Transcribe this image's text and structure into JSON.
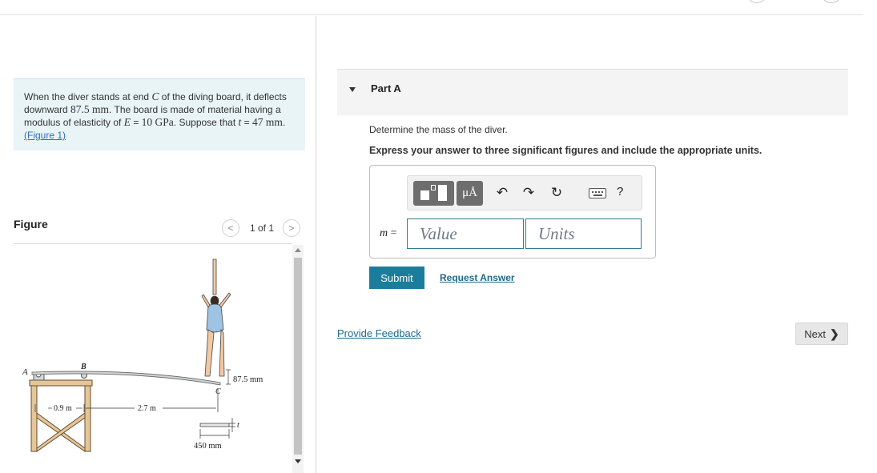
{
  "problem": {
    "t1": "When the diver stands at end ",
    "C": "C",
    "t2": " of the diving board, it deflects downward ",
    "deflection": "87.5 mm",
    "t3": ". The board is made of material having a modulus of elasticity of ",
    "E": "E",
    "t4": " = ",
    "modulus": "10 GPa",
    "t5": ". Suppose that ",
    "t": "t",
    "t6": " = ",
    "thickness": "47 mm",
    "t7": ". ",
    "figure_link": "(Figure 1)"
  },
  "figure": {
    "label": "Figure",
    "prev": "<",
    "next": ">",
    "page": "1 of 1",
    "labels": {
      "A": "A",
      "B": "B",
      "C": "C",
      "deflection": "87.5 mm",
      "d1": "0.9 m",
      "d2": "2.7 m",
      "t": "t",
      "width": "450 mm"
    }
  },
  "part": {
    "title": "Part A",
    "question": "Determine the mass of the diver.",
    "instructions": "Express your answer to three significant figures and include the appropriate units."
  },
  "toolbar": {
    "units_button": "μÅ",
    "undo": "↶",
    "redo": "↷",
    "reset": "↻",
    "help": "?"
  },
  "answer": {
    "variable": "m",
    "equals": " =",
    "value_placeholder": "Value",
    "units_placeholder": "Units"
  },
  "buttons": {
    "submit": "Submit",
    "request_answer": "Request Answer",
    "provide_feedback": "Provide Feedback",
    "next": "Next",
    "next_chevron": "❯"
  }
}
